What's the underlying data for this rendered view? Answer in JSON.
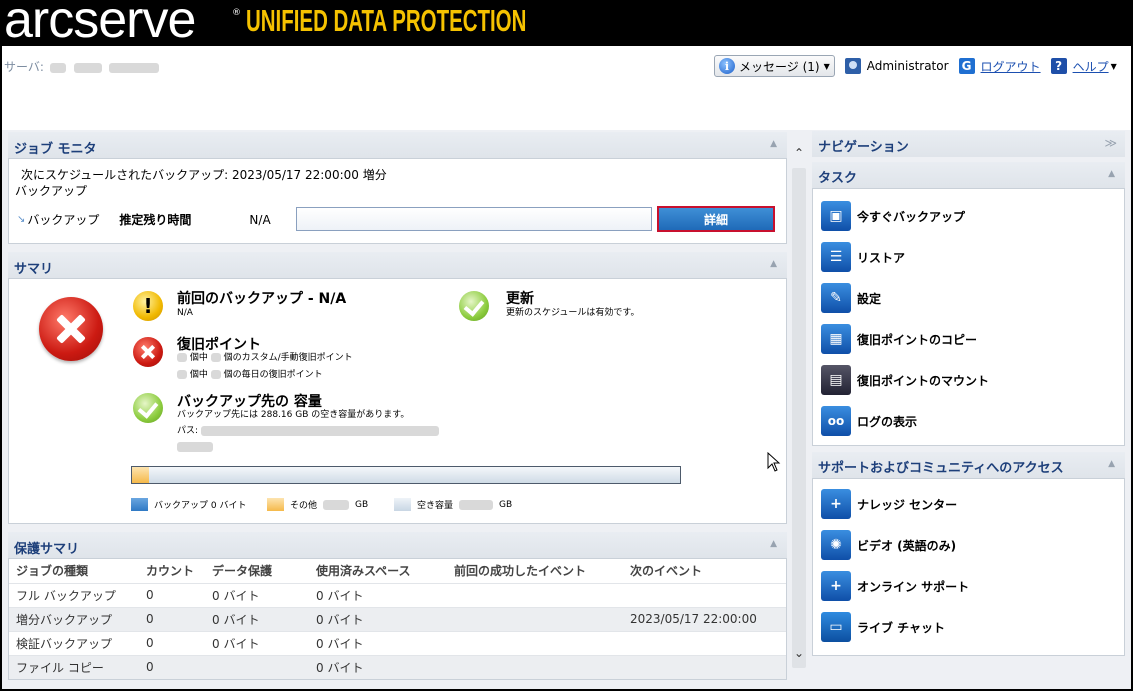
{
  "brand": {
    "name": "arcserve",
    "reg": "®",
    "product": "UNIFIED DATA PROTECTION"
  },
  "header": {
    "server_label": "サーバ:",
    "messages_label": "メッセージ (1)",
    "user": "Administrator",
    "logout": "ログアウト",
    "help": "ヘルプ"
  },
  "job_monitor": {
    "title": "ジョブ モニタ",
    "scheduled_line1": "次にスケジュールされたバックアップ: 2023/05/17 22:00:00 増分",
    "scheduled_line2": "バックアップ",
    "job_label": "バックアップ",
    "time_label": "推定残り時間",
    "time_value": "N/A",
    "detail_button": "詳細"
  },
  "summary": {
    "title": "サマリ",
    "last_backup_title": "前回のバックアップ - N/A",
    "last_backup_sub": "N/A",
    "update_title": "更新",
    "update_sub": "更新のスケジュールは有効です。",
    "recovery_title": "復旧ポイント",
    "recovery_sub1a": "個中",
    "recovery_sub1b": "個のカスタム/手動復旧ポイント",
    "recovery_sub2a": "個中",
    "recovery_sub2b": "個の毎日の復旧ポイント",
    "dest_title": "バックアップ先の 容量",
    "dest_sub": "バックアップ先には 288.16 GB の空き容量があります。",
    "path_label": "パス:",
    "used_fraction": 0.03,
    "legend_backup": "バックアップ 0 バイト",
    "legend_other": "その他",
    "legend_other_unit": "GB",
    "legend_free": "空き容量",
    "legend_free_unit": "GB",
    "colors": {
      "backup": "#2f79c4",
      "other": "#f5b94a",
      "free": "#c8d6e4"
    }
  },
  "protection": {
    "title": "保護サマリ",
    "headers": [
      "ジョブの種類",
      "カウント",
      "データ保護",
      "使用済みスペース",
      "前回の成功したイベント",
      "次のイベント"
    ],
    "rows": [
      [
        "フル バックアップ",
        "0",
        "0 バイト",
        "0 バイト",
        "",
        ""
      ],
      [
        "増分バックアップ",
        "0",
        "0 バイト",
        "0 バイト",
        "",
        "2023/05/17 22:00:00"
      ],
      [
        "検証バックアップ",
        "0",
        "0 バイト",
        "0 バイト",
        "",
        ""
      ],
      [
        "ファイル コピー",
        "0",
        "",
        "0 バイト",
        "",
        ""
      ]
    ]
  },
  "nav": {
    "title": "ナビゲーション",
    "expand": "≫",
    "tasks_title": "タスク",
    "tasks": [
      "今すぐバックアップ",
      "リストア",
      "設定",
      "復旧ポイントのコピー",
      "復旧ポイントのマウント",
      "ログの表示"
    ],
    "support_title": "サポートおよびコミュニティへのアクセス",
    "support": [
      "ナレッジ センター",
      "ビデオ (英語のみ)",
      "オンライン サポート",
      "ライブ チャット"
    ]
  }
}
